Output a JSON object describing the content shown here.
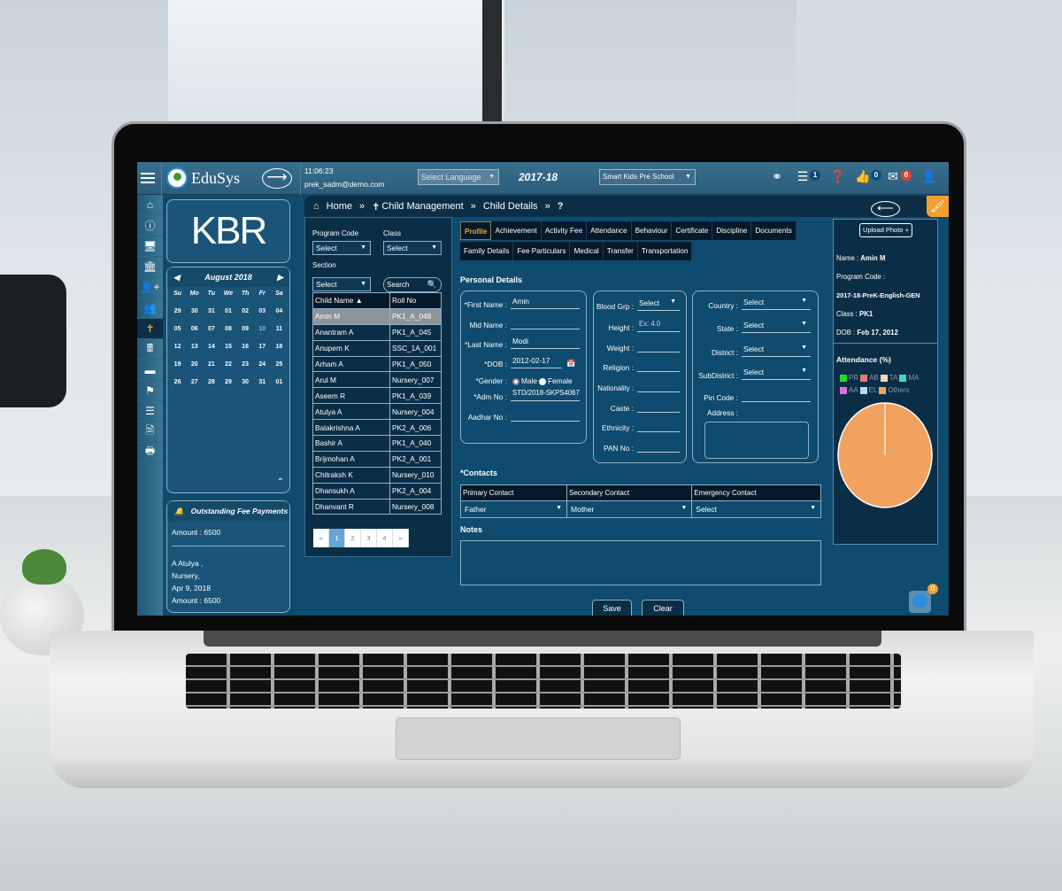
{
  "topbar": {
    "app_name": "EduSys",
    "time": "11:06:23",
    "user_email": "prek_sadm@demo.com",
    "language_select": "Select Language",
    "academic_year": "2017-18",
    "school_select": "Smart Kids Pre School",
    "tasks_badge": "1",
    "likes_badge": "0",
    "messages_badge": "0",
    "colors": {
      "badge_blue": "#0b4a7a",
      "badge_red": "#d9452e",
      "accent_orange": "#f0a030"
    }
  },
  "icon_sidebar": [
    "home-icon",
    "info-icon",
    "monitor-icon",
    "bank-icon",
    "add-user-icon",
    "users-icon",
    "child-icon",
    "calculator-icon",
    "card-icon",
    "flag-icon",
    "list-icon",
    "document-icon",
    "print-icon"
  ],
  "logo_text": "KBR",
  "calendar": {
    "month_label": "August 2018",
    "weekdays": [
      "Su",
      "Mo",
      "Tu",
      "We",
      "Th",
      "Fr",
      "Sa"
    ],
    "days": [
      "29",
      "30",
      "31",
      "01",
      "02",
      "03",
      "04",
      "05",
      "06",
      "07",
      "08",
      "09",
      "10",
      "11",
      "12",
      "13",
      "14",
      "15",
      "16",
      "17",
      "18",
      "19",
      "20",
      "21",
      "22",
      "23",
      "24",
      "25",
      "26",
      "27",
      "28",
      "29",
      "30",
      "31",
      "01"
    ]
  },
  "fee_panel": {
    "title": "Outstanding Fee Payments",
    "amount_total": "Amount : 6500",
    "entry_name": "A Atulya ,",
    "entry_class": "Nursery,",
    "entry_date": "Apr 9, 2018",
    "entry_amount": "Amount : 6500"
  },
  "filters": {
    "program_code_label": "Program Code",
    "program_code_value": "Select",
    "class_label": "Class",
    "class_value": "Select",
    "section_label": "Section",
    "section_value": "Select",
    "search_placeholder": "Search"
  },
  "children_table": {
    "headers": [
      "Child Name",
      "Roll No"
    ],
    "rows": [
      [
        "Amin M",
        "PK1_A_048"
      ],
      [
        "Anantram A",
        "PK1_A_045"
      ],
      [
        "Anupem K",
        "SSC_1A_001"
      ],
      [
        "Arham A",
        "PK1_A_050"
      ],
      [
        "Arul M",
        "Nursery_007"
      ],
      [
        "Aseem R",
        "PK1_A_039"
      ],
      [
        "Atulya A",
        "Nursery_004"
      ],
      [
        "Balakrishna A",
        "PK2_A_006"
      ],
      [
        "Bashir A",
        "PK1_A_040"
      ],
      [
        "Brijmohan A",
        "PK2_A_001"
      ],
      [
        "Chitraksh K",
        "Nursery_010"
      ],
      [
        "Dhansukh A",
        "PK2_A_004"
      ],
      [
        "Dhanvant R",
        "Nursery_008"
      ]
    ],
    "selected_index": 0,
    "pagination": [
      "«",
      "1",
      "2",
      "3",
      "4",
      "»"
    ],
    "current_page": "1"
  },
  "breadcrumb": {
    "home": "Home",
    "child_management": "Child Management",
    "child_details": "Child Details",
    "help": "?"
  },
  "tabs": {
    "row1": [
      "Profile",
      "Achievement",
      "Activity Fee",
      "Attendance",
      "Behaviour",
      "Certificate",
      "Discipline",
      "Documents"
    ],
    "row2": [
      "Family Details",
      "Fee Particulars",
      "Medical",
      "Transfer",
      "Transportation"
    ],
    "active": "Profile"
  },
  "personal_details": {
    "title": "Personal Details",
    "first_name_label": "*First Name :",
    "first_name": "Amin",
    "mid_name_label": "Mid Name :",
    "mid_name": "",
    "last_name_label": "*Last Name :",
    "last_name": "Modi",
    "dob_label": "*DOB :",
    "dob": "2012-02-17",
    "gender_label": "*Gender :",
    "gender_male": "Male",
    "gender_female": "Female",
    "gender_selected": "Male",
    "adm_no_label": "*Adm No :",
    "adm_no": "STD/2018-SKPS4067",
    "aadhar_label": "Aadhar No :",
    "aadhar": ""
  },
  "physical_details": {
    "blood_grp_label": "Blood Grp :",
    "blood_grp": "Select",
    "height_label": "Height :",
    "height_placeholder": "Ex: 4.0",
    "weight_label": "Weight :",
    "religion_label": "Religion :",
    "nationality_label": "Nationality :",
    "caste_label": "Caste :",
    "ethnicity_label": "Ethnicity :",
    "pan_label": "PAN No :"
  },
  "address_details": {
    "country_label": "Country :",
    "country": "Select",
    "state_label": "State :",
    "state": "Select",
    "district_label": "District :",
    "district": "Select",
    "subdistrict_label": "SubDistrict :",
    "subdistrict": "Select",
    "pin_label": "Pin Code :",
    "address_label": "Address :"
  },
  "contacts": {
    "title": "*Contacts",
    "headers": [
      "Primary Contact",
      "Secondary Contact",
      "Emergency Contact"
    ],
    "values": [
      "Father",
      "Mother",
      "Select"
    ]
  },
  "notes_label": "Notes",
  "buttons": {
    "save": "Save",
    "clear": "Clear",
    "upload_photo": "Upload Photo +"
  },
  "summary": {
    "name_label": "Name : ",
    "name": "Amin M",
    "program_code_label": "Program Code :",
    "program_code": "2017-18-PreK-English-GEN",
    "class_label": "Class : ",
    "class": "PK1",
    "dob_label": "DOB : ",
    "dob": "Feb 17, 2012"
  },
  "chat_badge": "0",
  "chart_data": {
    "type": "pie",
    "title": "Attendance (%)",
    "legend": [
      {
        "name": "PR",
        "color": "#22dd22"
      },
      {
        "name": "AB",
        "color": "#e87878"
      },
      {
        "name": "TA",
        "color": "#f6d7b0"
      },
      {
        "name": "MA",
        "color": "#40d8c8"
      },
      {
        "name": "AA",
        "color": "#e070e0"
      },
      {
        "name": "EL",
        "color": "#b8dcea"
      },
      {
        "name": "Others",
        "color": "#f2a25f"
      }
    ],
    "values": [
      0,
      0,
      0,
      0,
      0,
      0,
      100
    ]
  }
}
